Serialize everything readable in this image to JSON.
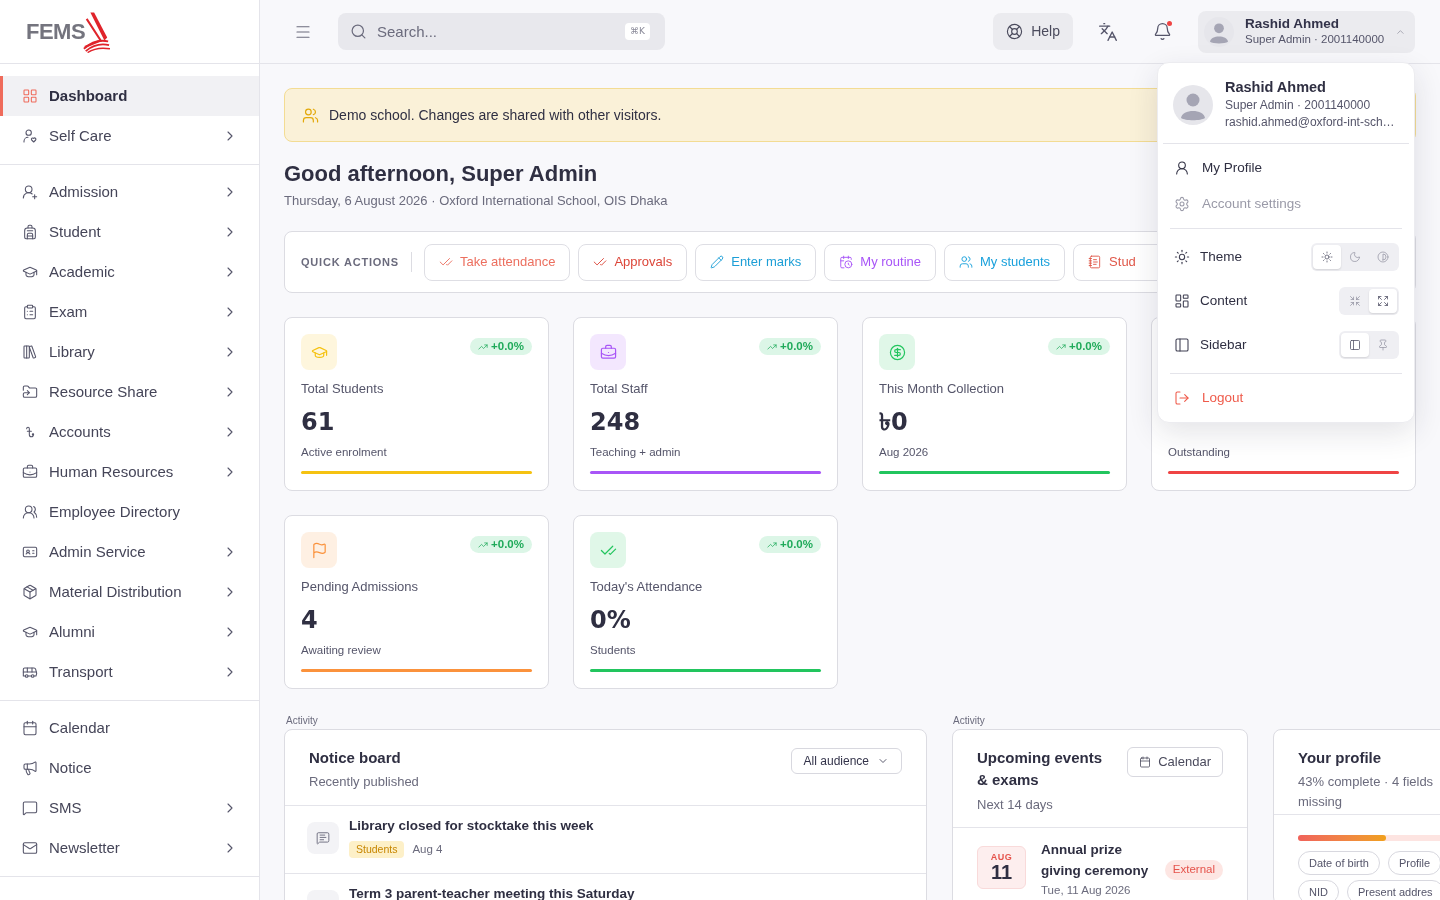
{
  "sidebar": {
    "logo": "FEMS",
    "sections": [
      [
        {
          "label": "Dashboard",
          "selected": true,
          "expandable": false
        },
        {
          "label": "Self Care",
          "selected": false,
          "expandable": true
        }
      ],
      [
        {
          "label": "Admission",
          "selected": false,
          "expandable": true
        },
        {
          "label": "Student",
          "selected": false,
          "expandable": true
        },
        {
          "label": "Academic",
          "selected": false,
          "expandable": true
        },
        {
          "label": "Exam",
          "selected": false,
          "expandable": true
        },
        {
          "label": "Library",
          "selected": false,
          "expandable": true
        },
        {
          "label": "Resource Share",
          "selected": false,
          "expandable": true
        },
        {
          "label": "Accounts",
          "selected": false,
          "expandable": true
        },
        {
          "label": "Human Resources",
          "selected": false,
          "expandable": true
        },
        {
          "label": "Employee Directory",
          "selected": false,
          "expandable": false
        },
        {
          "label": "Admin Service",
          "selected": false,
          "expandable": true
        },
        {
          "label": "Material Distribution",
          "selected": false,
          "expandable": true
        },
        {
          "label": "Alumni",
          "selected": false,
          "expandable": true
        },
        {
          "label": "Transport",
          "selected": false,
          "expandable": true
        }
      ],
      [
        {
          "label": "Calendar",
          "selected": false,
          "expandable": false
        },
        {
          "label": "Notice",
          "selected": false,
          "expandable": false
        },
        {
          "label": "SMS",
          "selected": false,
          "expandable": true
        },
        {
          "label": "Newsletter",
          "selected": false,
          "expandable": true
        }
      ]
    ]
  },
  "topbar": {
    "search": {
      "placeholder": "Search...",
      "shortcut": "⌘K"
    },
    "help": "Help",
    "notifications": {
      "unread": true
    },
    "account": {
      "name": "Rashid Ahmed",
      "detail": "Super Admin · 2001140000",
      "expanded": true
    }
  },
  "banner": "Demo school. Changes are shared with other visitors.",
  "greeting": {
    "title": "Good afternoon, Super Admin",
    "subtitle": "Thursday, 6 August 2026 · Oxford International School, OIS Dhaka"
  },
  "quick_actions": {
    "label": "QUICK ACTIONS",
    "items": [
      {
        "label": "Take attendance",
        "color": "#ec6f5f"
      },
      {
        "label": "Approvals",
        "color": "#dc4538"
      },
      {
        "label": "Enter marks",
        "color": "#1c9ed6"
      },
      {
        "label": "My routine",
        "color": "#a855f7"
      },
      {
        "label": "My students",
        "color": "#1aa1dc"
      },
      {
        "label": "Stud",
        "color": "#e0584a"
      }
    ]
  },
  "stats": [
    {
      "label": "Total Students",
      "value": "61",
      "note": "Active enrolment",
      "change": "+0.0%",
      "color": "#f5c211"
    },
    {
      "label": "Total Staff",
      "value": "248",
      "note": "Teaching + admin",
      "change": "+0.0%",
      "color": "#a855f7"
    },
    {
      "label": "This Month Collection",
      "value": "৳0",
      "note": "Aug 2026",
      "change": "+0.0%",
      "color": "#22c55e"
    },
    {
      "note": "Outstanding",
      "color": "#ef4444"
    },
    {
      "label": "Pending Admissions",
      "value": "4",
      "note": "Awaiting review",
      "change": "+0.0%",
      "color": "#fb923c"
    },
    {
      "label": "Today's Attendance",
      "value": "0%",
      "note": "Students",
      "change": "+0.0%",
      "color": "#22c55e"
    }
  ],
  "notice_board": {
    "section_label": "Activity",
    "title": "Notice board",
    "subtitle": "Recently published",
    "filter": "All audience",
    "items": [
      {
        "title": "Library closed for stocktake this week",
        "tag": "Students",
        "date": "Aug 4"
      },
      {
        "title": "Term 3 parent-teacher meeting this Saturday"
      }
    ]
  },
  "events": {
    "section_label": "Activity",
    "title": "Upcoming events & exams",
    "subtitle": "Next 14 days",
    "action": "Calendar",
    "items": [
      {
        "month": "AUG",
        "day": "11",
        "title": "Annual prize giving ceremony",
        "date": "Tue, 11 Aug 2026",
        "tag": "External"
      }
    ]
  },
  "profile": {
    "title": "Your profile",
    "summary": "43% complete · 4 fields missing",
    "level": 0.43,
    "missing": [
      "Date of birth",
      "Profile",
      "NID",
      "Present addres"
    ]
  },
  "user_menu": {
    "name": "Rashid Ahmed",
    "detail": "Super Admin · 2001140000",
    "email": "rashid.ahmed@oxford-int-sch…",
    "items": [
      {
        "label": "My Profile",
        "disabled": false
      },
      {
        "label": "Account settings",
        "disabled": true
      }
    ],
    "preferences": [
      {
        "label": "Theme",
        "options": [
          {
            "selected": true
          },
          {
            "selected": false
          },
          {
            "selected": false
          }
        ]
      },
      {
        "label": "Content",
        "options": [
          {
            "selected": false
          },
          {
            "selected": true
          }
        ]
      },
      {
        "label": "Sidebar",
        "options": [
          {
            "selected": true
          },
          {
            "selected": false
          }
        ]
      }
    ],
    "logout": "Logout"
  }
}
